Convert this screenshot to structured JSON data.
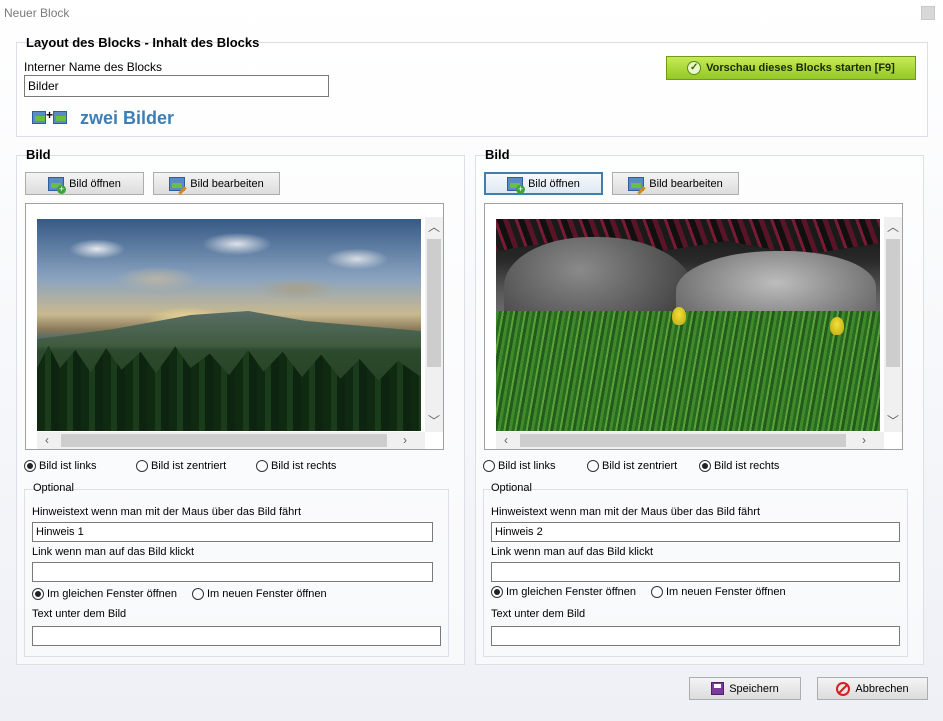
{
  "window": {
    "title": "Neuer Block"
  },
  "layout_group": {
    "title": "Layout des Blocks - Inhalt des Blocks",
    "internal_name_label": "Interner Name des Blocks",
    "internal_name_value": "Bilder",
    "layout_type_label": "zwei Bilder",
    "layout_type_color": "#3d7fb5",
    "preview_button": "Vorschau dieses Blocks starten [F9]"
  },
  "left_panel": {
    "title": "Bild",
    "open_button": "Bild öffnen",
    "edit_button": "Bild bearbeiten",
    "align_left": "Bild ist links",
    "align_center": "Bild ist zentriert",
    "align_right": "Bild ist rechts",
    "selected_alignment": "left",
    "optional_title": "Optional",
    "hint_label": "Hinweistext wenn man mit der Maus über das Bild fährt",
    "hint_value": "Hinweis 1",
    "link_label": "Link wenn man auf das Bild klickt",
    "link_value": "",
    "same_window": "Im gleichen Fenster öffnen",
    "new_window": "Im neuen Fenster öffnen",
    "selected_target": "same",
    "caption_label": "Text unter dem Bild",
    "caption_value": ""
  },
  "right_panel": {
    "title": "Bild",
    "open_button": "Bild öffnen",
    "edit_button": "Bild bearbeiten",
    "align_left": "Bild ist links",
    "align_center": "Bild ist zentriert",
    "align_right": "Bild ist rechts",
    "selected_alignment": "right",
    "optional_title": "Optional",
    "hint_label": "Hinweistext wenn man mit der Maus über das Bild fährt",
    "hint_value": "Hinweis 2",
    "link_label": "Link wenn man auf das Bild klickt",
    "link_value": "",
    "same_window": "Im gleichen Fenster öffnen",
    "new_window": "Im neuen Fenster öffnen",
    "selected_target": "same",
    "caption_label": "Text unter dem Bild",
    "caption_value": ""
  },
  "footer": {
    "save_button": "Speichern",
    "cancel_button": "Abbrechen"
  },
  "icons": {
    "preview": "check-circle-icon",
    "open": "image-add-icon",
    "edit": "image-edit-icon",
    "save": "floppy-disk-icon",
    "cancel": "no-entry-icon",
    "layout_type": "two-images-icon"
  }
}
